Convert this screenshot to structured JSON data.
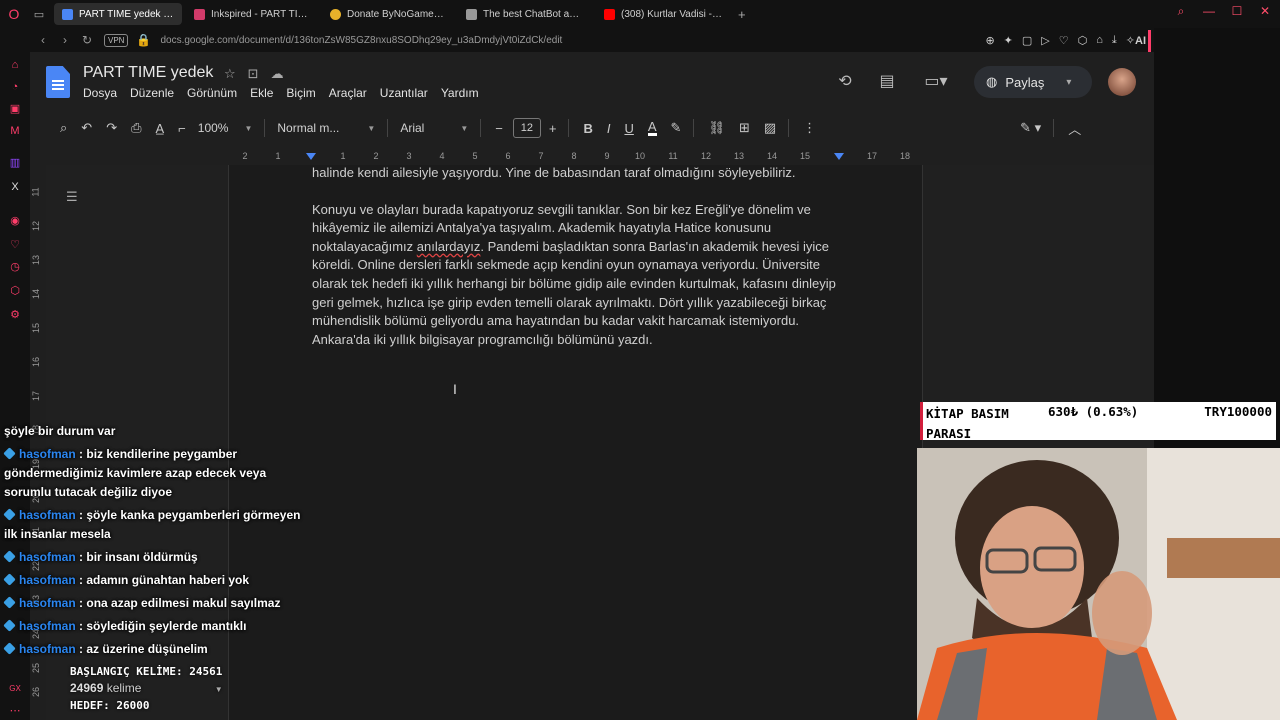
{
  "browser": {
    "tabs": [
      {
        "title": "PART TIME yedek - Google",
        "active": true,
        "fav_color": "#4a86f5"
      },
      {
        "title": "Inkspired - PART TIME",
        "active": false,
        "fav_color": "#d23b6a"
      },
      {
        "title": "Donate ByNoGame - Geio",
        "active": false,
        "fav_color": "#e7b12a"
      },
      {
        "title": "The best ChatBot and Wi",
        "active": false,
        "fav_color": "#999999"
      },
      {
        "title": "(308) Kurtlar Vadisi - 64.B",
        "active": false,
        "fav_color": "#ff0000"
      }
    ],
    "new_tab": "+",
    "vpn": "VPN",
    "url": "docs.google.com/document/d/136tonZsW85GZ8nxu8SODhq29ey_u3aDmdyjVt0iZdCk/edit",
    "ai_label": "AI"
  },
  "docs": {
    "title": "PART TIME  yedek",
    "menu": [
      "Dosya",
      "Düzenle",
      "Görünüm",
      "Ekle",
      "Biçim",
      "Araçlar",
      "Uzantılar",
      "Yardım"
    ],
    "share_label": "Paylaş",
    "toolbar": {
      "zoom": "100%",
      "style": "Normal m...",
      "font": "Arial",
      "font_size": "12"
    },
    "ruler_numbers": [
      "2",
      "1",
      "1",
      "2",
      "3",
      "4",
      "5",
      "6",
      "7",
      "8",
      "9",
      "10",
      "11",
      "12",
      "13",
      "14",
      "15",
      "16",
      "17",
      "18"
    ],
    "vruler_numbers": [
      "11",
      "12",
      "13",
      "14",
      "15",
      "16",
      "17",
      "18",
      "19",
      "20",
      "21",
      "22",
      "23",
      "24",
      "25",
      "26"
    ],
    "content": {
      "para1": "halinde kendi ailesiyle yaşıyordu. Yine de babasından taraf olmadığını söyleyebiliriz.",
      "para2_a": "Konuyu ve olayları burada kapatıyoruz sevgili tanıklar. Son bir kez Ereğli'ye dönelim ve hikâyemiz ile ailemizi Antalya'ya taşıyalım. Akademik hayatıyla Hatice konusunu noktalayacağımız ",
      "para2_misspelled": "anılardayız",
      "para2_b": ". Pandemi başladıktan sonra Barlas'ın akademik hevesi iyice köreldi. Online dersleri farklı sekmede açıp kendini oyun oynamaya veriyordu. Üniversite olarak tek hedefi iki yıllık herhangi bir bölüme gidip aile evinden kurtulmak, kafasını dinleyip geri gelmek, hızlıca işe girip evden temelli olarak ayrılmaktı. Dört yıllık yazabileceği birkaç mühendislik bölümü geliyordu ama hayatından bu kadar vakit harcamak istemiyordu. Ankara'da iki yıllık bilgisayar programcılığı bölümünü yazdı."
    }
  },
  "chat": {
    "messages": [
      {
        "user": "",
        "text": "şöyle bir durum var"
      },
      {
        "user": "hasofman",
        "text": ": biz kendilerine peygamber göndermediğimiz kavimlere azap edecek veya sorumlu tutacak değiliz diyoe"
      },
      {
        "user": "hasofman",
        "text": ": şöyle kanka peygamberleri görmeyen ilk insanlar mesela"
      },
      {
        "user": "hasofman",
        "text": ": bir insanı öldürmüş"
      },
      {
        "user": "hasofman",
        "text": ": adamın günahtan haberi yok"
      },
      {
        "user": "hasofman",
        "text": ": ona azap edilmesi makul sayılmaz"
      },
      {
        "user": "hasofman",
        "text": ": söylediğin şeylerde mantıklı"
      },
      {
        "user": "hasofman",
        "text": ": az üzerine düşünelim"
      }
    ]
  },
  "wordcount": {
    "start": "BAŞLANGIÇ KELİME: 24561",
    "current_number": "24969",
    "current_unit": "kelime",
    "goal": "HEDEF: 26000"
  },
  "goal_widget": {
    "label": "KİTAP BASIM PARASI",
    "current": "630₺ (0.63%)",
    "target": "TRY100000",
    "accent": "#d21e3c"
  }
}
